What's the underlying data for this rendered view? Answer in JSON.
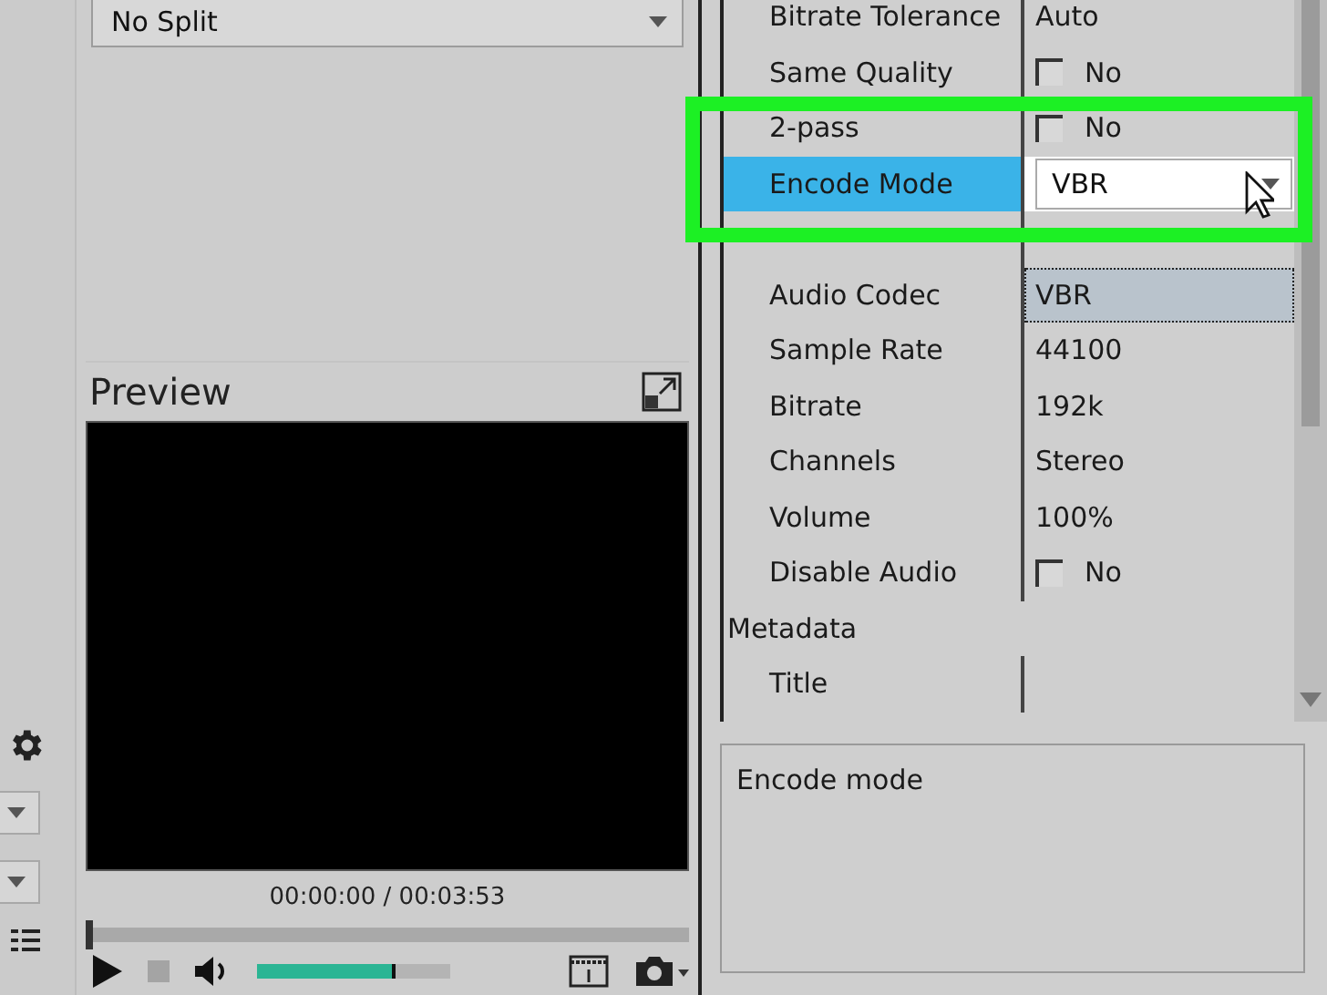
{
  "split_select": {
    "value": "No Split"
  },
  "preview": {
    "title": "Preview",
    "time": "00:00:00 / 00:03:53",
    "seek": {
      "level": 0
    },
    "volume": {
      "level": 0.7
    }
  },
  "properties": [
    {
      "kind": "text",
      "label": "Bitrate Tolerance",
      "value": "Auto",
      "selected": false,
      "focused": false
    },
    {
      "kind": "check",
      "label": "Same Quality",
      "value": "No",
      "checked": false,
      "selected": false,
      "focused": false
    },
    {
      "kind": "check",
      "label": "2-pass",
      "value": "No",
      "checked": false,
      "selected": false,
      "focused": false
    },
    {
      "kind": "select",
      "label": "Encode Mode",
      "value": "VBR",
      "selected": true,
      "focused": false
    },
    {
      "kind": "blank"
    },
    {
      "kind": "text",
      "label": "Audio Codec",
      "value": "VBR",
      "selected": false,
      "focused": true
    },
    {
      "kind": "text",
      "label": "Sample Rate",
      "value": "44100",
      "selected": false,
      "focused": false
    },
    {
      "kind": "text",
      "label": "Bitrate",
      "value": "192k",
      "selected": false,
      "focused": false
    },
    {
      "kind": "text",
      "label": "Channels",
      "value": "Stereo",
      "selected": false,
      "focused": false
    },
    {
      "kind": "text",
      "label": "Volume",
      "value": "100%",
      "selected": false,
      "focused": false
    },
    {
      "kind": "check",
      "label": "Disable Audio",
      "value": "No",
      "checked": false,
      "selected": false,
      "focused": false
    },
    {
      "kind": "category",
      "label": "Metadata"
    },
    {
      "kind": "text",
      "label": "Title",
      "selected": false,
      "focused": false
    }
  ],
  "description": "Encode mode"
}
